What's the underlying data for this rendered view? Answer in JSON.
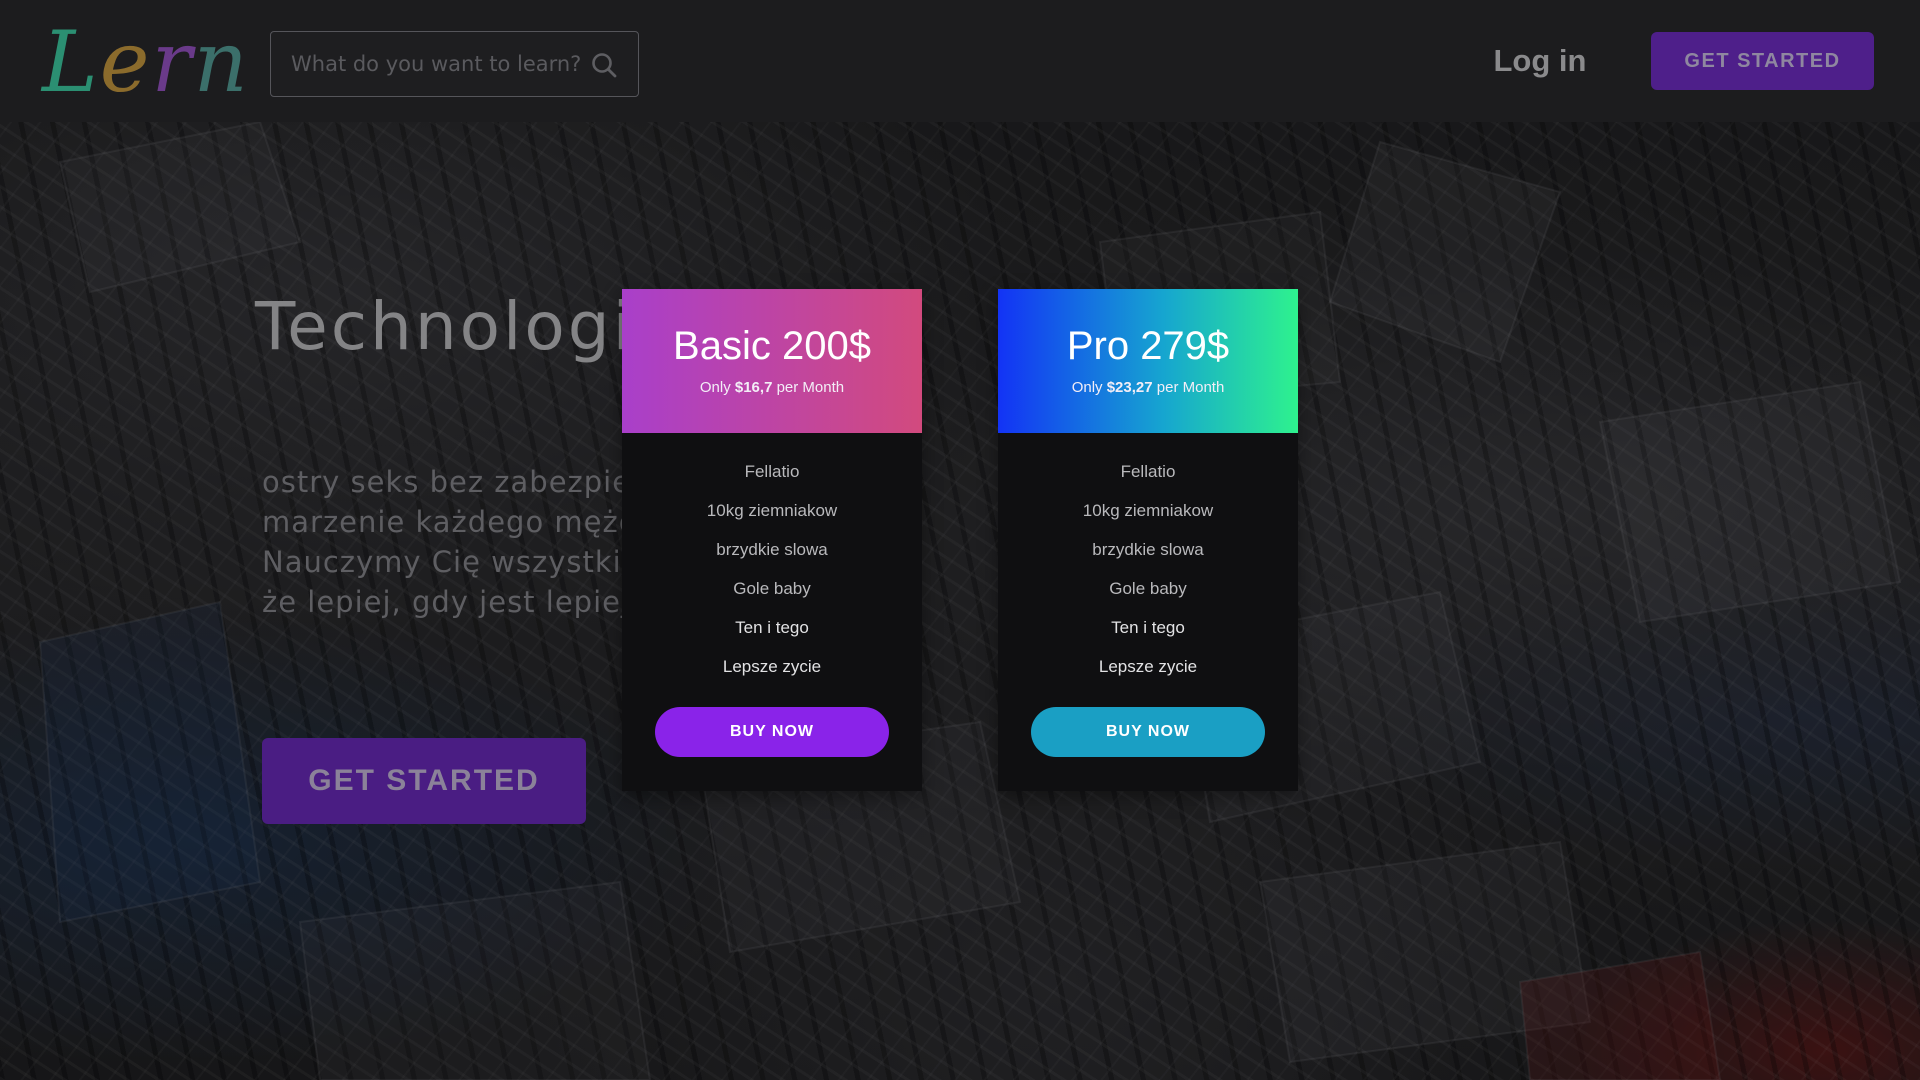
{
  "colors": {
    "header_bg": "#1c1c1e",
    "cta_purple": "#4e1f8a",
    "basic_gradient": [
      "#a93fca",
      "#d24a7e"
    ],
    "pro_gradient": [
      "#1333f5",
      "#16a5d0",
      "#2ef28e"
    ],
    "basic_button": "#8a23e9",
    "pro_button": "#1a9fc4"
  },
  "header": {
    "logo_letters": [
      "L",
      "e",
      "r",
      "n"
    ],
    "search_placeholder": "What do you want to learn?",
    "search_icon": "search-icon",
    "login_label": "Log in",
    "get_started_label": "GET STARTED"
  },
  "hero": {
    "title": "Technologie",
    "lines": [
      "ostry seks bez zabezpiec",
      "marzenie każdego mężcz",
      "Nauczymy Cię wszystkieg",
      "że lepiej, gdy jest lepiej."
    ],
    "cta_label": "GET STARTED"
  },
  "plans": [
    {
      "title": "Basic 200$",
      "sub_prefix": "Only ",
      "sub_price": "$16,7",
      "sub_suffix": " per Month",
      "features": [
        "Fellatio",
        "10kg ziemniakow",
        "brzydkie slowa",
        "Gole baby",
        "Ten i tego",
        "Lepsze zycie"
      ],
      "button_label": "BUY NOW"
    },
    {
      "title": "Pro 279$",
      "sub_prefix": "Only ",
      "sub_price": "$23,27",
      "sub_suffix": " per Month",
      "features": [
        "Fellatio",
        "10kg ziemniakow",
        "brzydkie slowa",
        "Gole baby",
        "Ten i tego",
        "Lepsze zycie"
      ],
      "button_label": "BUY NOW"
    }
  ]
}
